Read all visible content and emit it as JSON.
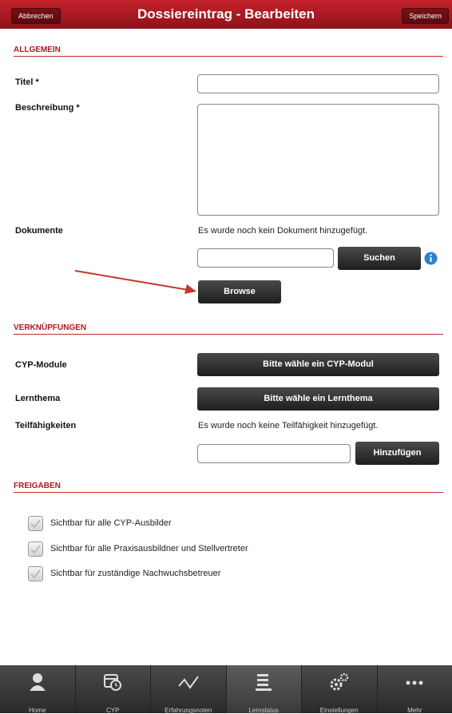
{
  "header": {
    "cancel_label": "Abbrechen",
    "title": "Dossiereintrag - Bearbeiten",
    "save_label": "Speichern"
  },
  "general": {
    "section_title": "ALLGEMEIN",
    "title_label": "Titel *",
    "title_value": "",
    "description_label": "Beschreibung *",
    "description_value": "",
    "documents_label": "Dokumente",
    "documents_empty": "Es wurde noch kein Dokument hinzugefügt.",
    "search_label": "Suchen",
    "browse_label": "Browse"
  },
  "links": {
    "section_title": "VERKNÜPFUNGEN",
    "cyp_label": "CYP-Module",
    "cyp_select": "Bitte wähle ein CYP-Modul",
    "topic_label": "Lernthema",
    "topic_select": "Bitte wähle ein Lernthema",
    "skills_label": "Teilfähigkeiten",
    "skills_empty": "Es wurde noch keine Teilfähigkeit hinzugefügt.",
    "add_label": "Hinzufügen"
  },
  "sharing": {
    "section_title": "FREIGABEN",
    "options": [
      {
        "label": "Sichtbar für alle CYP-Ausbilder",
        "checked": true
      },
      {
        "label": "Sichtbar für alle Praxisausbildner und Stellvertreter",
        "checked": true
      },
      {
        "label": "Sichtbar für zuständige Nachwuchsbetreuer",
        "checked": true
      }
    ]
  },
  "tabs": [
    {
      "label": "Home",
      "icon": "user-icon"
    },
    {
      "label": "CYP",
      "icon": "calendar-clock-icon"
    },
    {
      "label": "Erfahrungsnoten",
      "icon": "chart-line-icon"
    },
    {
      "label": "Lernstatus",
      "icon": "list-icon",
      "active": true
    },
    {
      "label": "Einstellungen",
      "icon": "gears-icon"
    },
    {
      "label": "Mehr",
      "icon": "more-icon"
    }
  ],
  "colors": {
    "header": "#b01820",
    "section_rule": "#c92a2a",
    "annotation_arrow": "#c0392b"
  }
}
